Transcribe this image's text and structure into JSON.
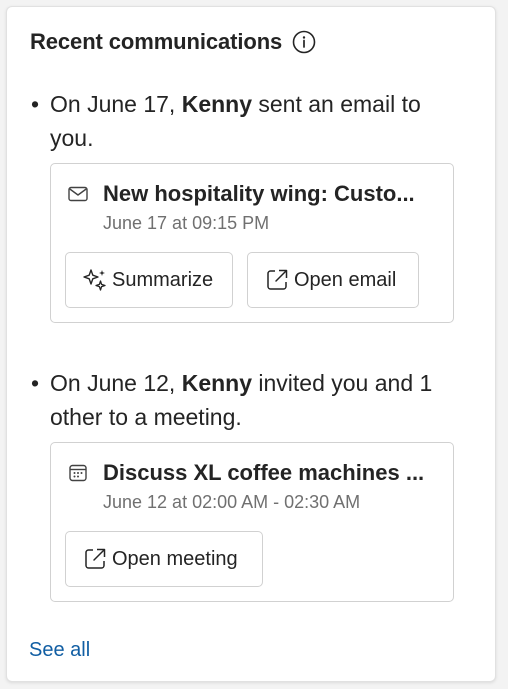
{
  "header": {
    "title": "Recent communications",
    "info_icon": "info-icon"
  },
  "items": [
    {
      "bullet": "•",
      "prefix": "On June 17, ",
      "actor": "Kenny",
      "suffix": " sent an email to you.",
      "card": {
        "icon": "mail-icon",
        "title": "New hospitality wing: Custo...",
        "subtitle": "June 17 at 09:15 PM",
        "buttons": [
          {
            "label": "Summarize",
            "icon": "sparkle-icon"
          },
          {
            "label": "Open email",
            "icon": "open-external-icon"
          }
        ]
      }
    },
    {
      "bullet": "•",
      "prefix": "On June 12, ",
      "actor": "Kenny",
      "suffix": " invited you and 1 other to a meeting.",
      "card": {
        "icon": "calendar-icon",
        "title": "Discuss XL coffee machines ...",
        "subtitle": "June 12 at 02:00 AM - 02:30 AM",
        "buttons": [
          {
            "label": "Open meeting",
            "icon": "open-external-icon"
          }
        ]
      }
    }
  ],
  "footer": {
    "see_all": "See all"
  },
  "colors": {
    "link": "#115ea3",
    "text": "#242424",
    "muted": "#707070",
    "border": "#d1d1d1"
  }
}
